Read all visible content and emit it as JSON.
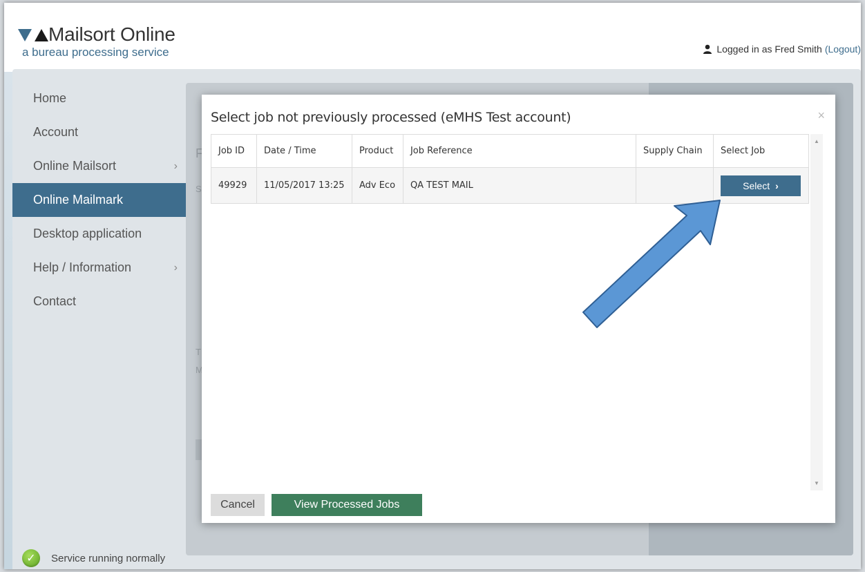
{
  "header": {
    "app_title": "Mailsort Online",
    "app_subtitle": "a bureau processing service",
    "logged_in_text": "Logged in as Fred Smith",
    "logout_label": "(Logout)"
  },
  "sidebar": {
    "items": [
      {
        "label": "Home",
        "has_chevron": false
      },
      {
        "label": "Account",
        "has_chevron": false
      },
      {
        "label": "Online Mailsort",
        "has_chevron": true
      },
      {
        "label": "Online Mailmark",
        "has_chevron": false,
        "active": true
      },
      {
        "label": "Desktop application",
        "has_chevron": false
      },
      {
        "label": "Help / Information",
        "has_chevron": true
      },
      {
        "label": "Contact",
        "has_chevron": false
      }
    ],
    "chevron": "›",
    "status_text": "Service running normally"
  },
  "modal": {
    "title": "Select job not previously processed (eMHS Test account)",
    "close_glyph": "×",
    "columns": [
      "Job ID",
      "Date / Time",
      "Product",
      "Job Reference",
      "Supply Chain",
      "Select Job"
    ],
    "rows": [
      {
        "job_id": "49929",
        "date_time": "11/05/2017 13:25",
        "product": "Adv Eco",
        "job_reference": "QA TEST MAIL",
        "supply_chain": "",
        "select_label": "Select",
        "select_chevron": "›"
      }
    ],
    "cancel_label": "Cancel",
    "processed_label": "View Processed Jobs"
  },
  "colors": {
    "brand_blue": "#3e6d8d",
    "green_button": "#3e7f5c",
    "annotation_arrow": "#5b97d5"
  }
}
